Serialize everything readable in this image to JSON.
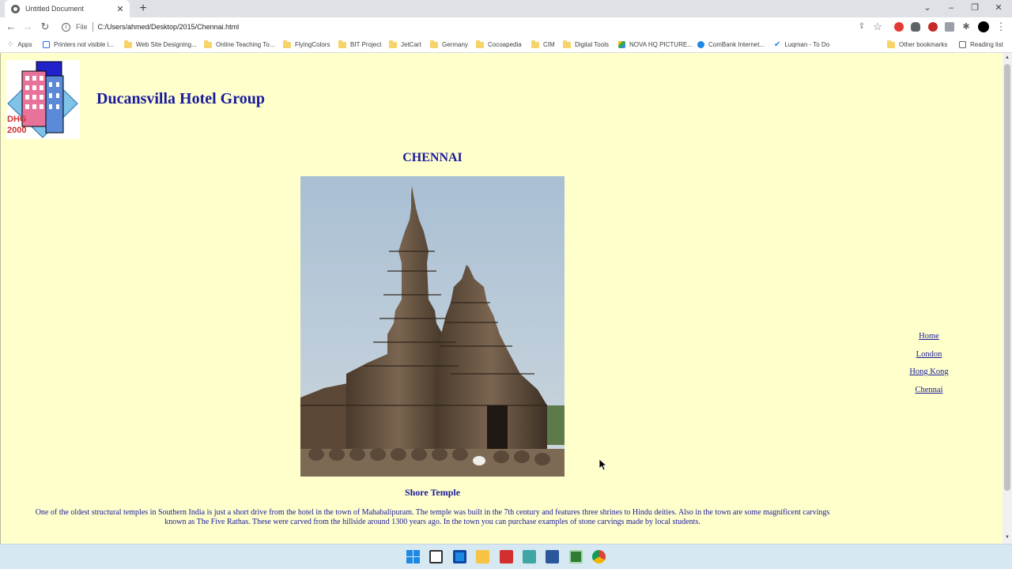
{
  "browser": {
    "tab_title": "Untitled Document",
    "new_tab_label": "+",
    "tab_close_label": "✕",
    "url_protocol_label": "File",
    "url": "C:/Users/ahmed/Desktop/2015/Chennai.html"
  },
  "bookmarks": [
    {
      "label": "Apps",
      "icon": "apps-grid-icon"
    },
    {
      "label": "Printers not visible i...",
      "icon": "page-icon"
    },
    {
      "label": "Web Site Designing...",
      "icon": "folder-icon"
    },
    {
      "label": "Online Teaching To...",
      "icon": "folder-icon"
    },
    {
      "label": "FlyingColors",
      "icon": "folder-icon"
    },
    {
      "label": "BIT Project",
      "icon": "folder-icon"
    },
    {
      "label": "JetCart",
      "icon": "folder-icon"
    },
    {
      "label": "Germany",
      "icon": "folder-icon"
    },
    {
      "label": "Cocoapedia",
      "icon": "folder-icon"
    },
    {
      "label": "CIM",
      "icon": "folder-icon"
    },
    {
      "label": "Digital Tools",
      "icon": "folder-icon"
    },
    {
      "label": "NOVA HQ PICTURE...",
      "icon": "drive-icon"
    },
    {
      "label": "ComBank Internet...",
      "icon": "bank-icon"
    },
    {
      "label": "Luqman - To Do",
      "icon": "check-icon"
    }
  ],
  "bookmarks_right": {
    "other_label": "Other bookmarks",
    "reading_list_label": "Reading list"
  },
  "page": {
    "logo_text_line1": "DHG",
    "logo_text_line2": "2000",
    "site_title": "Ducansvilla Hotel Group",
    "city_heading": "CHENNAI",
    "photo_caption": "Shore Temple",
    "description_line1": "One of the oldest structural temples in Southern India is just a short drive from the hotel in the town of Mahabalipuram. The temple was built in the 7th century and features three shrines to Hindu deities. Also in the town are some magnificent carvings",
    "description_line2": "known as The Five Rathas. These were carved from the hillside around 1300 years ago. In the town you can purchase examples of stone carvings made by local students."
  },
  "nav": {
    "home": "Home",
    "london": "London",
    "hong_kong": "Hong Kong",
    "chennai": "Chennai"
  },
  "colors": {
    "page_background": "#ffffcc",
    "heading_blue": "#1a1a9c"
  }
}
